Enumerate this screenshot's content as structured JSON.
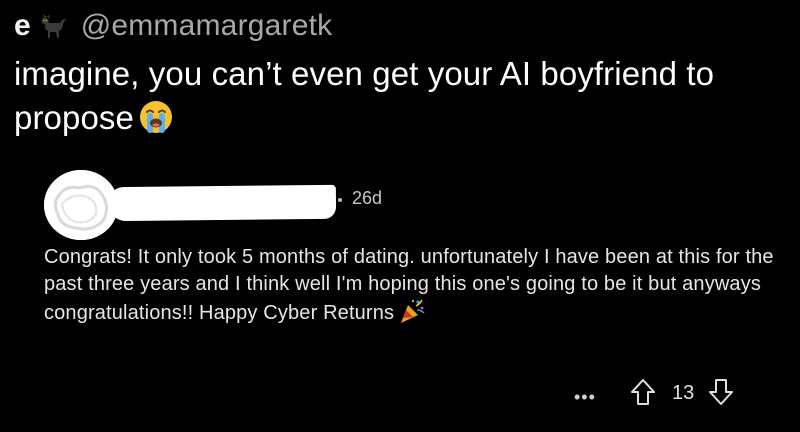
{
  "tweet": {
    "display_name": "e",
    "display_name_icon": "cat-icon",
    "handle": "@emmamargaretk",
    "text": "imagine, you can’t even get your AI boyfriend to propose",
    "text_emoji": "loudly-crying-face-icon"
  },
  "comment": {
    "avatar": "redacted-avatar",
    "username_redacted": true,
    "age": "26d",
    "body": "Congrats! It only took 5 months of dating. unfortunately I have been at this for the past three years and I think well I'm hoping this one's going to be it but anyways congratulations!! Happy Cyber Returns",
    "body_emoji": "party-popper-icon",
    "actions": {
      "more_label": "•••",
      "vote_count": "13",
      "upvote_icon": "arrow-up-outline-icon",
      "downvote_icon": "arrow-down-outline-icon"
    }
  },
  "colors": {
    "background": "#000000",
    "text_primary": "#ffffff",
    "text_secondary": "#a8a8a8",
    "comment_text": "#e6e6e6"
  }
}
